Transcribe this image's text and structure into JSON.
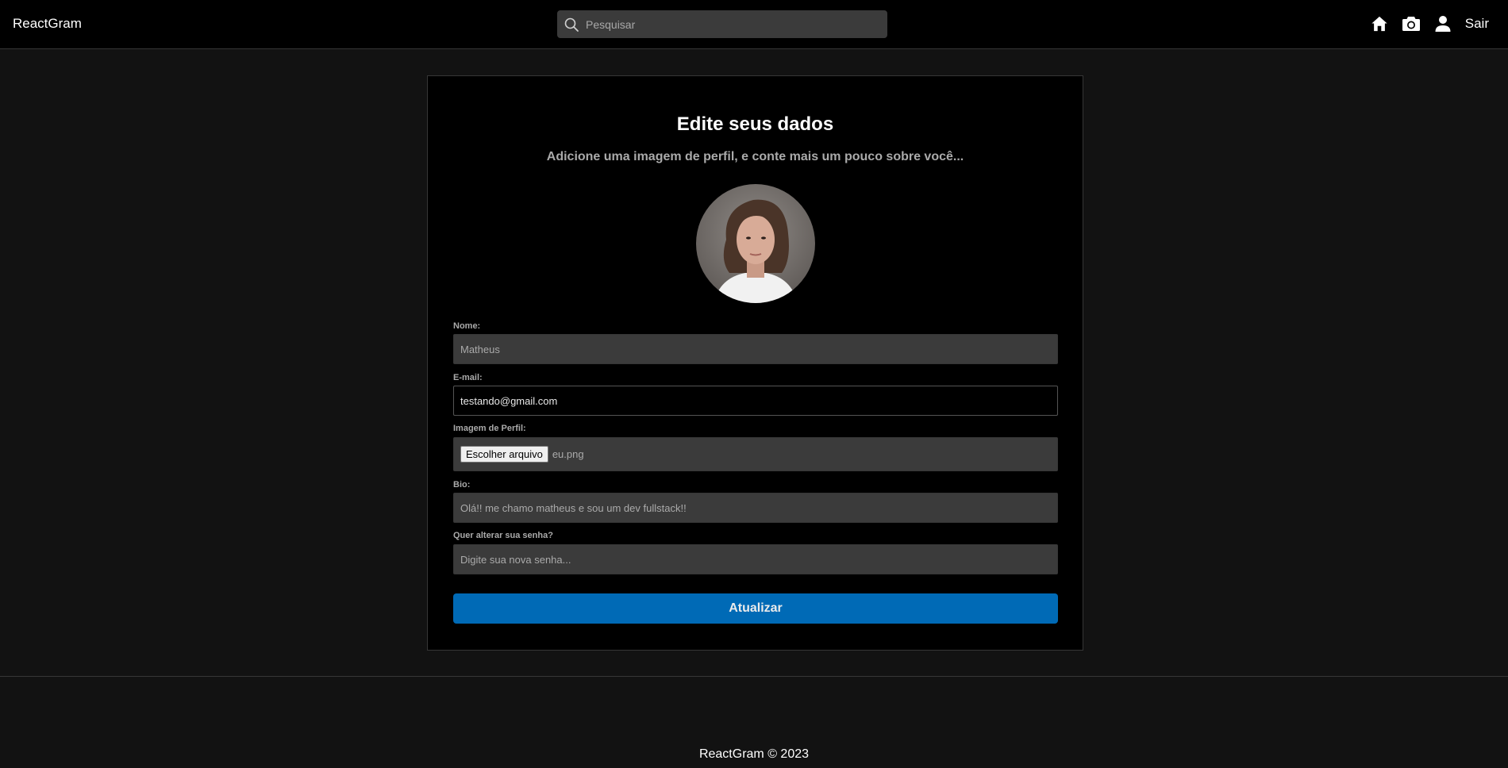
{
  "navbar": {
    "brand": "ReactGram",
    "search_placeholder": "Pesquisar",
    "icons": [
      "house-icon",
      "camera-icon",
      "user-icon"
    ],
    "logout_label": "Sair"
  },
  "edit_profile": {
    "title": "Edite seus dados",
    "subtitle": "Adicione uma imagem de perfil, e conte mais um pouco sobre você...",
    "fields": {
      "name": {
        "label": "Nome:",
        "value": "Matheus"
      },
      "email": {
        "label": "E-mail:",
        "value": "testando@gmail.com"
      },
      "image": {
        "label": "Imagem de Perfil:",
        "button_label": "Escolher arquivo",
        "file_name": "eu.png"
      },
      "bio": {
        "label": "Bio:",
        "value": "Olá!! me chamo matheus e sou um dev fullstack!!"
      },
      "password": {
        "label": "Quer alterar sua senha?",
        "placeholder": "Digite sua nova senha..."
      }
    },
    "submit_label": "Atualizar"
  },
  "footer": {
    "text": "ReactGram © 2023"
  },
  "colors": {
    "background": "#121212",
    "navbar": "#000000",
    "card": "#000000",
    "input": "#3b3b3b",
    "accent": "#0073c6"
  }
}
